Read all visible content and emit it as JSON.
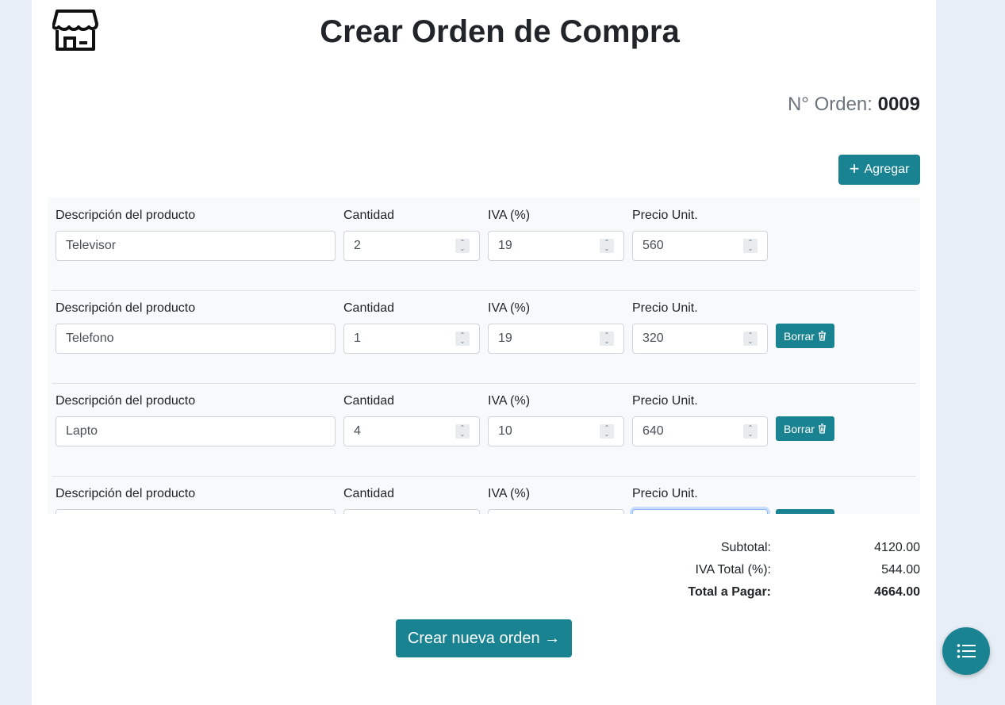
{
  "header": {
    "title": "Crear Orden de Compra",
    "order_label": "N° Orden:",
    "order_number": "0009",
    "logo_icon": "store-icon"
  },
  "toolbar": {
    "add_label": "Agregar",
    "add_icon": "plus-icon"
  },
  "columns": {
    "description": "Descripción del producto",
    "quantity": "Cantidad",
    "iva": "IVA (%)",
    "price": "Precio Unit."
  },
  "items": [
    {
      "description": "Televisor",
      "quantity": "2",
      "iva": "19",
      "price": "560"
    },
    {
      "description": "Telefono",
      "quantity": "1",
      "iva": "19",
      "price": "320",
      "delete_label": "Borrar"
    },
    {
      "description": "Lapto",
      "quantity": "4",
      "iva": "10",
      "price": "640",
      "delete_label": "Borrar"
    },
    {
      "description": "",
      "quantity": "",
      "iva": "",
      "price": ""
    }
  ],
  "totals": {
    "subtotal_label": "Subtotal:",
    "subtotal_value": "4120.00",
    "iva_label": "IVA Total (%):",
    "iva_value": "544.00",
    "total_label": "Total a Pagar:",
    "total_value": "4664.00"
  },
  "actions": {
    "create_label": "Crear nueva orden →"
  },
  "fab": {
    "icon": "list-icon"
  },
  "colors": {
    "primary": "#198391",
    "background": "#e8eef7"
  }
}
